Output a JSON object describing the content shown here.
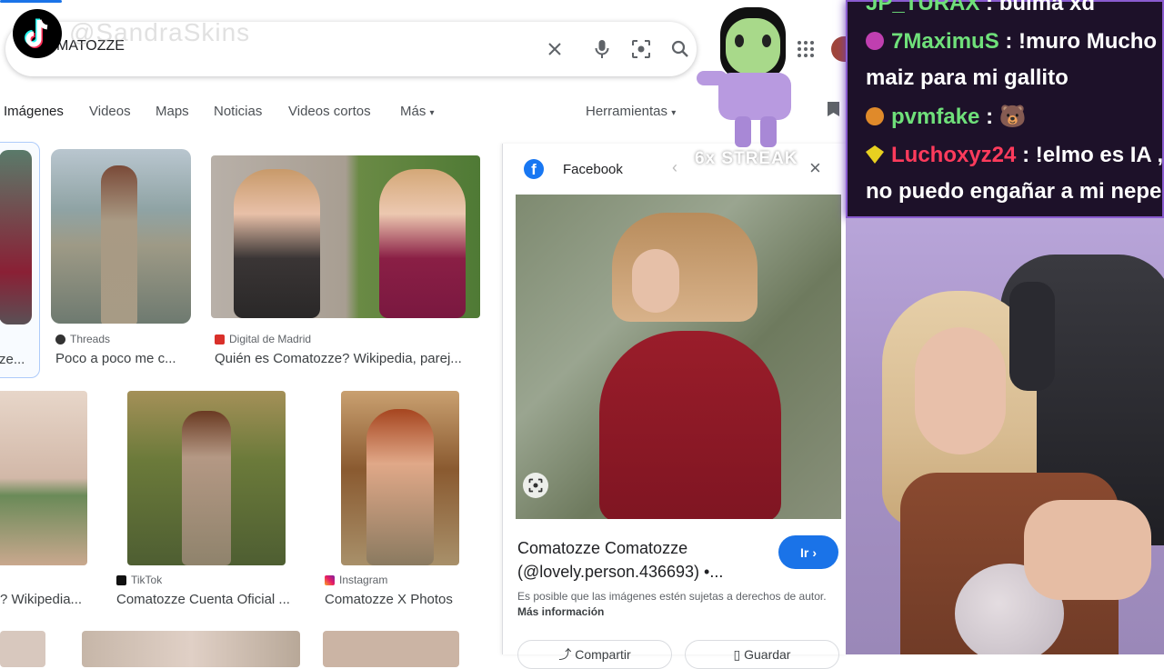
{
  "search": {
    "query": "MATOZZE"
  },
  "overlay": {
    "watermark": "@SandraSkins",
    "streak": "6x STREAK"
  },
  "tabs": [
    {
      "label": "Imágenes",
      "active": true
    },
    {
      "label": "Videos"
    },
    {
      "label": "Maps"
    },
    {
      "label": "Noticias"
    },
    {
      "label": "Videos cortos"
    },
    {
      "label": "Más"
    }
  ],
  "tools": {
    "label": "Herramientas"
  },
  "results_row1": [
    {
      "caption": "ze..."
    },
    {
      "source": "Threads",
      "caption": "Poco a poco me c..."
    },
    {
      "source": "Digital de Madrid",
      "caption": "Quién es Comatozze? Wikipedia, parej..."
    }
  ],
  "results_row2": [
    {
      "caption": "? Wikipedia..."
    },
    {
      "source": "TikTok",
      "caption": "Comatozze Cuenta Oficial ..."
    },
    {
      "source": "Instagram",
      "caption": "Comatozze X Photos"
    }
  ],
  "panel": {
    "source": "Facebook",
    "title_line1": "Comatozze Comatozze",
    "title_line2": "(@lovely.person.436693) •...",
    "go_label": "Ir",
    "notice": "Es posible que las imágenes estén sujetas a derechos de autor.",
    "more_info": "Más información",
    "share_label": "Compartir",
    "save_label": "Guardar"
  },
  "chat": [
    {
      "user": "JP_TURAX",
      "msg": ": bulma xd",
      "color": "#6fe07a",
      "badge": "#6fe07a"
    },
    {
      "user": "7MaximuS",
      "msg": ": !muro Mucho",
      "msg2": "maiz para mi gallito",
      "color": "#6fe07a",
      "badge": "#c03fb0"
    },
    {
      "user": "pvmfake",
      "msg": ": 🐻",
      "color": "#6fe07a",
      "badge": "#e08a2a"
    },
    {
      "user": "Luchoxyz24",
      "msg": ": !elmo es IA ,",
      "msg2": "no puedo engañar a mi nepe",
      "color": "#ff3b5c",
      "badge": "#e8d020"
    }
  ],
  "colors": {
    "accent": "#1a73e8",
    "chat_border": "#8a5cd0",
    "go_button": "#1a73e8"
  }
}
